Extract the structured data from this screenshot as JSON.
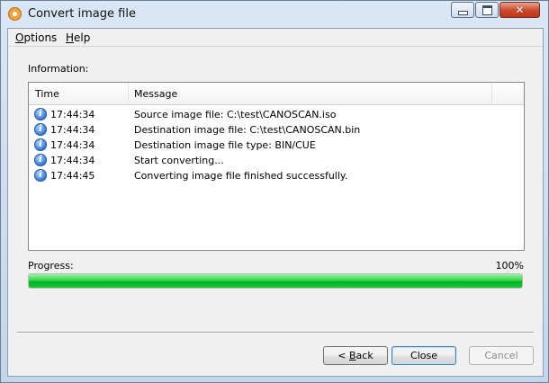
{
  "window": {
    "title": "Convert image file"
  },
  "menu": [
    {
      "label": "Options",
      "accel": "O",
      "rest": "ptions"
    },
    {
      "label": "Help",
      "accel": "H",
      "rest": "elp"
    }
  ],
  "info_label": "Information:",
  "log": {
    "columns": [
      "Time",
      "Message"
    ],
    "rows": [
      {
        "time": "17:44:34",
        "message": "Source image file:  C:\\test\\CANOSCAN.iso",
        "icon": "info-icon"
      },
      {
        "time": "17:44:34",
        "message": "Destination image file:  C:\\test\\CANOSCAN.bin",
        "icon": "info-icon"
      },
      {
        "time": "17:44:34",
        "message": "Destination image file type:  BIN/CUE",
        "icon": "info-icon"
      },
      {
        "time": "17:44:34",
        "message": "Start converting...",
        "icon": "info-icon"
      },
      {
        "time": "17:44:45",
        "message": "Converting image file finished successfully.",
        "icon": "info-icon"
      }
    ]
  },
  "progress": {
    "label": "Progress:",
    "percent_text": "100%",
    "value": 1.0
  },
  "buttons": {
    "back": {
      "pre": "< ",
      "accel": "B",
      "rest": "ack",
      "label": "< Back"
    },
    "close": "Close",
    "cancel": "Cancel"
  },
  "colors": {
    "progress_green": "#06b025",
    "close_caption": "#c9472a"
  }
}
